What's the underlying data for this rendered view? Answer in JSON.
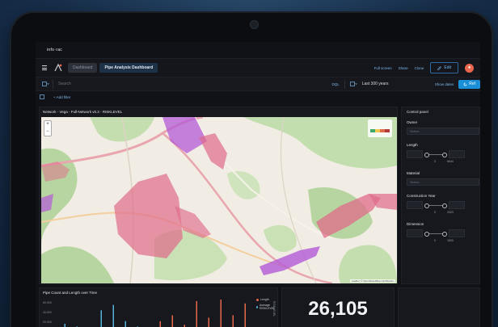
{
  "app": {
    "brand_prefix": "info",
    "brand_suffix": "rac"
  },
  "toolbar": {
    "crumb_dashboard": "Dashboard",
    "crumb_current": "Pipe Analysis Dashboard",
    "full_screen": "Full screen",
    "share": "Share",
    "clone": "Clone",
    "edit": "Edit"
  },
  "search": {
    "placeholder": "Search",
    "dql": "DQL",
    "time_range": "Last 300 years",
    "show_dates": "Show dates",
    "refresh": "Ref"
  },
  "filters": {
    "add_filter": "+ Add filter"
  },
  "map_panel": {
    "title": "Network - Vega - Full-Network v0.3 - RISKLEVEL",
    "zoom_in": "+",
    "zoom_out": "−",
    "attribution": "Leaflet | © OpenStreetMap contributors"
  },
  "control_panel": {
    "title": "Control panel",
    "owner_label": "Owner",
    "owner_placeholder": "Select...",
    "length_label": "Length",
    "length_min": "0",
    "length_max": "6644",
    "material_label": "Material",
    "material_placeholder": "Select...",
    "construction_label": "Construction Year",
    "construction_min": "0",
    "construction_max": "2023",
    "dimension_label": "Dimension",
    "dimension_min": "0",
    "dimension_max": "1600"
  },
  "chart_panel": {
    "title": "Pipe Count and Length over Time",
    "y_ticks": [
      "60,000",
      "40,000",
      "20,000"
    ],
    "legend_length": "Length",
    "legend_avg": "Average RISKLEVEL",
    "legend_axis": "RISKLEVEL"
  },
  "metric_panel": {
    "value": "26,105"
  },
  "colors": {
    "accent": "#1b8fd8",
    "link": "#7ab6ea",
    "length_series": "#e7664c",
    "risk_series": "#54b3d6"
  },
  "chart_data": {
    "type": "bar",
    "title": "Pipe Count and Length over Time",
    "series": [
      {
        "name": "Length",
        "values": [
          0,
          0,
          0,
          0,
          0,
          0,
          0,
          0,
          9000,
          14000,
          6000,
          26000,
          12000,
          30000,
          14000,
          24000
        ]
      },
      {
        "name": "Average RISKLEVEL",
        "values": [
          3,
          2,
          1,
          8,
          10,
          4,
          2,
          1,
          0,
          0,
          0,
          0,
          0,
          0,
          0,
          0
        ]
      }
    ],
    "ylim": [
      0,
      60000
    ]
  }
}
